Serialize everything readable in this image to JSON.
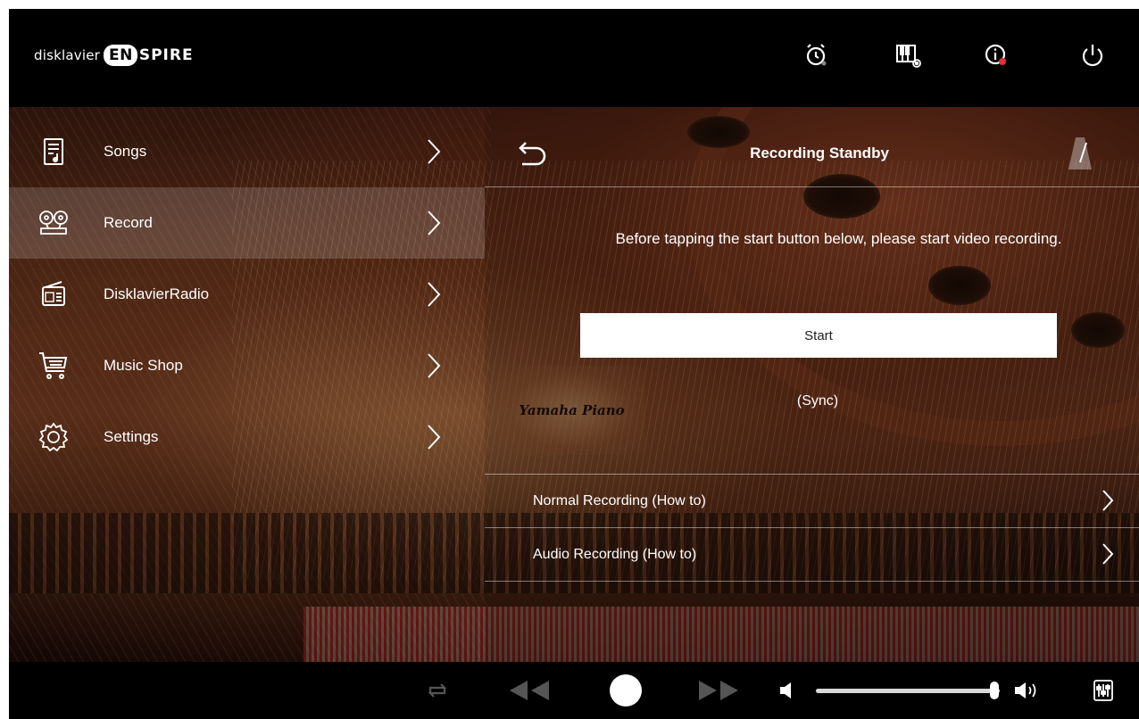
{
  "header": {
    "logo": {
      "prefix": "disklavier",
      "badge": "EN",
      "suffix": "SPIRE"
    },
    "icons": [
      "timer-icon",
      "piano-settings-icon",
      "info-icon",
      "power-icon"
    ]
  },
  "sidebar": {
    "items": [
      {
        "label": "Songs",
        "icon": "songs-icon",
        "active": false
      },
      {
        "label": "Record",
        "icon": "record-tape-icon",
        "active": true
      },
      {
        "label": "DisklavierRadio",
        "icon": "radio-icon",
        "active": false
      },
      {
        "label": "Music Shop",
        "icon": "cart-icon",
        "active": false
      },
      {
        "label": "Settings",
        "icon": "gear-icon",
        "active": false
      }
    ]
  },
  "panel": {
    "title": "Recording Standby",
    "instruction": "Before tapping the start button below, please start video recording.",
    "start_label": "Start",
    "sync_label": "(Sync)",
    "rows": [
      {
        "label": "Normal Recording (How to)"
      },
      {
        "label": "Audio Recording (How to)"
      }
    ]
  },
  "player": {
    "volume_fraction": 0.97,
    "colors": {
      "disabled": "#555555",
      "enabled": "#ffffff"
    }
  },
  "crest_text": "Yamaha Piano"
}
